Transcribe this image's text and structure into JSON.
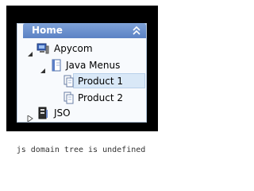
{
  "tree": {
    "header": {
      "title": "Home",
      "collapse_icon": "double-chevron-up-icon"
    },
    "items": [
      {
        "label": "Apycom",
        "icon": "computer-icon",
        "expanded": true
      },
      {
        "label": "Java Menus",
        "icon": "document-book-icon",
        "expanded": true
      },
      {
        "label": "Product 1",
        "icon": "pages-icon",
        "selected": true
      },
      {
        "label": "Product 2",
        "icon": "pages-icon"
      },
      {
        "label": "JSO",
        "icon": "server-icon",
        "expanded": false
      }
    ]
  },
  "caption": "js domain tree is undefined",
  "colors": {
    "header": "#6a90cc",
    "selected_row": "#d9e8f7",
    "frame": "#000000"
  }
}
